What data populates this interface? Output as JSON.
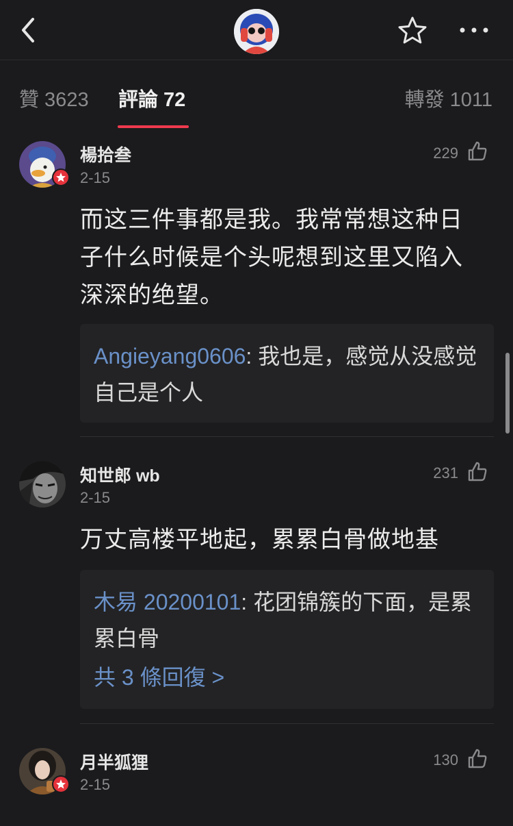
{
  "header": {
    "back_icon": "chevron-left-icon",
    "star_icon": "star-outline-icon",
    "more_icon": "more-horizontal-icon"
  },
  "tabs": [
    {
      "label": "贊 3623"
    },
    {
      "label": "評論 72"
    },
    {
      "label": "轉發 1011"
    }
  ],
  "comments": [
    {
      "user": "楊拾叁",
      "date": "2-15",
      "likes": "229",
      "text": "而这三件事都是我。我常常想这种日子什么时候是个头呢想到这里又陷入深深的绝望。",
      "reply": {
        "user": "Angieyang0606",
        "sep": ": ",
        "text": "我也是，感觉从没感觉自己是个人"
      }
    },
    {
      "user": "知世郎 wb",
      "date": "2-15",
      "likes": "231",
      "text": "万丈高楼平地起，累累白骨做地基",
      "reply": {
        "user": "木易 20200101",
        "sep": ": ",
        "text": "花团锦簇的下面，是累累白骨"
      },
      "more_replies": "共 3 條回復 >"
    },
    {
      "user": "月半狐狸",
      "date": "2-15",
      "likes": "130"
    }
  ],
  "colors": {
    "background": "#1b1b1d",
    "accent": "#ef3a4e",
    "link": "#6a91c9",
    "badge": "#e5323b"
  }
}
